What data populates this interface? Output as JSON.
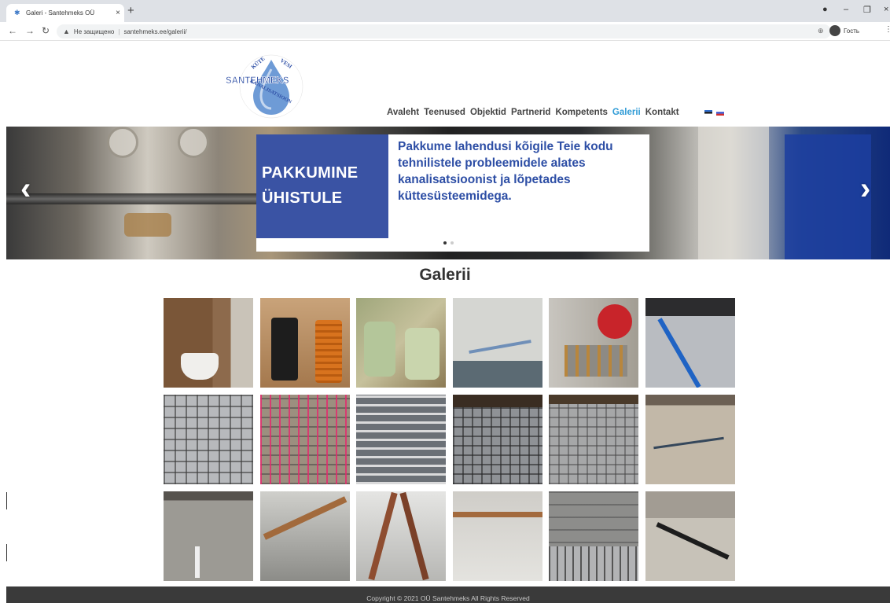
{
  "browser": {
    "tab_title": "Galeri - Santehmeks OÜ",
    "tab_close": "×",
    "new_tab": "+",
    "insecure_label": "Не защищено",
    "url": "santehmeks.ee/galerii/",
    "profile_label": "Гость"
  },
  "nav": {
    "items": [
      "Avaleht",
      "Teenused",
      "Objektid",
      "Partnerid",
      "Kompetents",
      "Galerii",
      "Kontakt"
    ],
    "active": "Galerii"
  },
  "logo": {
    "top_left": "KÜTE",
    "top_right": "VESI",
    "brand": "SANTEHMEKS",
    "bottom": "KANALISATSIOON"
  },
  "slider": {
    "heading_line1": "PAKKUMINE",
    "heading_line2": "ÜHISTULE",
    "text": "Pakkume lahendusi kõigile Teie kodu tehnilistele probleemidele alates kanalisatsioonist ja lõpetades küttesüsteemidega.",
    "prev": "‹",
    "next": "›",
    "slide_count": 2,
    "active_slide": 1
  },
  "gallery": {
    "title": "Galerii",
    "images": [
      "toilet-icon",
      "black-orange-pipes",
      "septic-tanks",
      "wall-pipes",
      "red-boiler",
      "blue-floor-pipes",
      "floor-heating-mesh",
      "pink-heating-mesh",
      "floor-heating-coils",
      "rebar-mesh",
      "floor-mesh",
      "concrete-floor",
      "floor-pipes",
      "ceiling-copper-pipes",
      "copper-risers",
      "wall-copper-pipes",
      "block-wall-mesh",
      "floor-pipes-black"
    ]
  },
  "footer": {
    "copyright": "Copyright © 2021 OÜ Santehmeks All Rights Reserved"
  },
  "colors": {
    "accent": "#2f9bd6",
    "banner_blue": "#3a53a4",
    "banner_text": "#2d4ea5",
    "footer_bg": "#3a3a3a"
  }
}
